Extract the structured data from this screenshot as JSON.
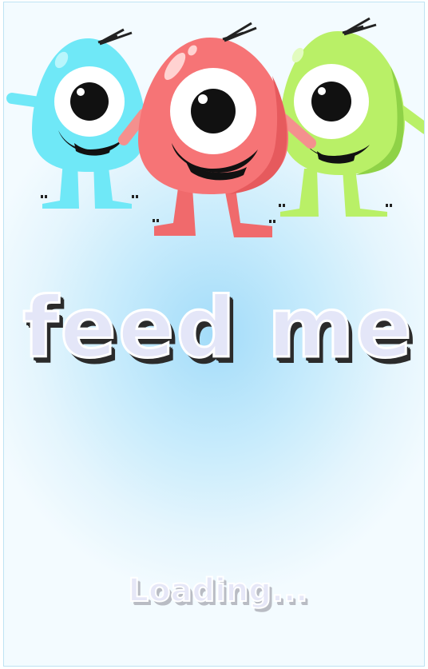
{
  "title": "feed me",
  "loading_text": "Loading...",
  "colors": {
    "monster_blue": "#6fe8f7",
    "monster_red": "#f67476",
    "monster_green": "#b9f067",
    "background_center": "#a3dcf9",
    "title_fill": "#e4e6f8"
  },
  "monsters": [
    "blue-monster",
    "red-monster",
    "green-monster"
  ]
}
